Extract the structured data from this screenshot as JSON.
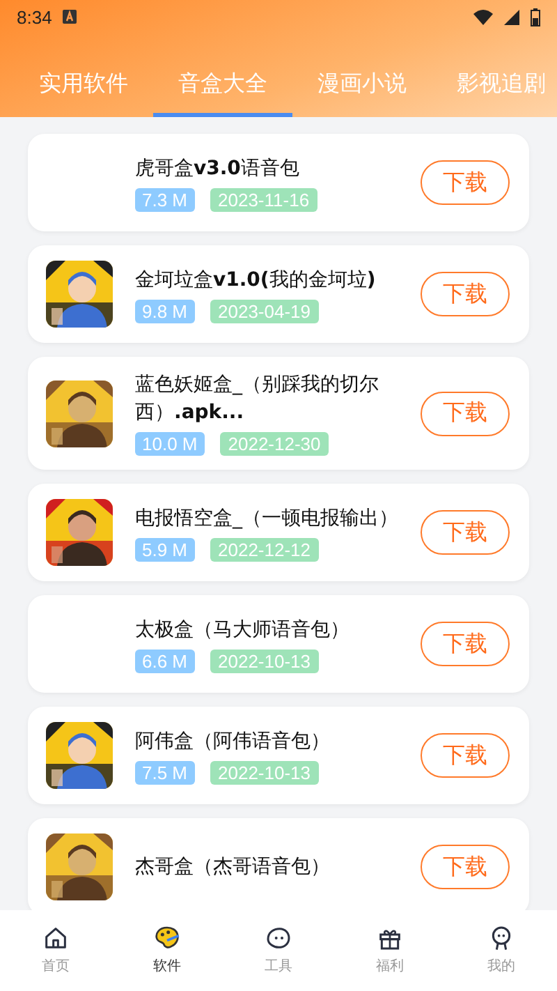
{
  "status_bar": {
    "time": "8:34"
  },
  "tabs": [
    {
      "label": "实用软件",
      "selected": false
    },
    {
      "label": "音盒大全",
      "selected": true
    },
    {
      "label": "漫画小说",
      "selected": false
    },
    {
      "label": "影视追剧",
      "selected": false
    }
  ],
  "items": [
    {
      "title": "虎哥盒**v3.0**语音包",
      "size": "7.3 M",
      "date": "2023-11-16",
      "button": "下载"
    },
    {
      "title": "金坷垃盒**v1.0(**我的金坷垃**)**",
      "size": "9.8 M",
      "date": "2023-04-19",
      "button": "下载"
    },
    {
      "title": "蓝色妖姬盒_（别踩我的切尔西）**.apk...**",
      "size": "10.0 M",
      "date": "2022-12-30",
      "button": "下载"
    },
    {
      "title": "电报悟空盒_（一顿电报输出）",
      "size": "5.9 M",
      "date": "2022-12-12",
      "button": "下载"
    },
    {
      "title": "太极盒（马大师语音包）",
      "size": "6.6 M",
      "date": "2022-10-13",
      "button": "下载"
    },
    {
      "title": "阿伟盒（阿伟语音包）",
      "size": "7.5 M",
      "date": "2022-10-13",
      "button": "下载"
    },
    {
      "title": "杰哥盒（杰哥语音包）",
      "button": "下载"
    }
  ],
  "bottom_nav": [
    {
      "label": "首页",
      "kind": "home",
      "selected": false
    },
    {
      "label": "软件",
      "kind": "palette",
      "selected": true
    },
    {
      "label": "工具",
      "kind": "blob",
      "selected": false
    },
    {
      "label": "福利",
      "kind": "gift",
      "selected": false
    },
    {
      "label": "我的",
      "kind": "person",
      "selected": false
    }
  ]
}
